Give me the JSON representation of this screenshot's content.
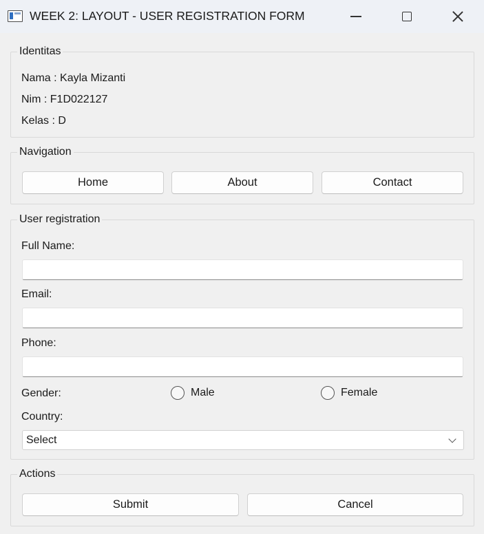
{
  "window": {
    "title": "WEEK 2: LAYOUT - USER REGISTRATION FORM"
  },
  "identitas": {
    "title": "Identitas",
    "nama": "Nama : Kayla Mizanti",
    "nim": "Nim : F1D022127",
    "kelas": "Kelas : D"
  },
  "navigation": {
    "title": "Navigation",
    "home_label": "Home",
    "about_label": "About",
    "contact_label": "Contact"
  },
  "registration": {
    "title": "User registration",
    "full_name_label": "Full Name:",
    "full_name_value": "",
    "email_label": "Email:",
    "email_value": "",
    "phone_label": "Phone:",
    "phone_value": "",
    "gender_label": "Gender:",
    "gender_options": [
      "Male",
      "Female"
    ],
    "country_label": "Country:",
    "country_selected": "Select"
  },
  "actions": {
    "title": "Actions",
    "submit_label": "Submit",
    "cancel_label": "Cancel"
  }
}
